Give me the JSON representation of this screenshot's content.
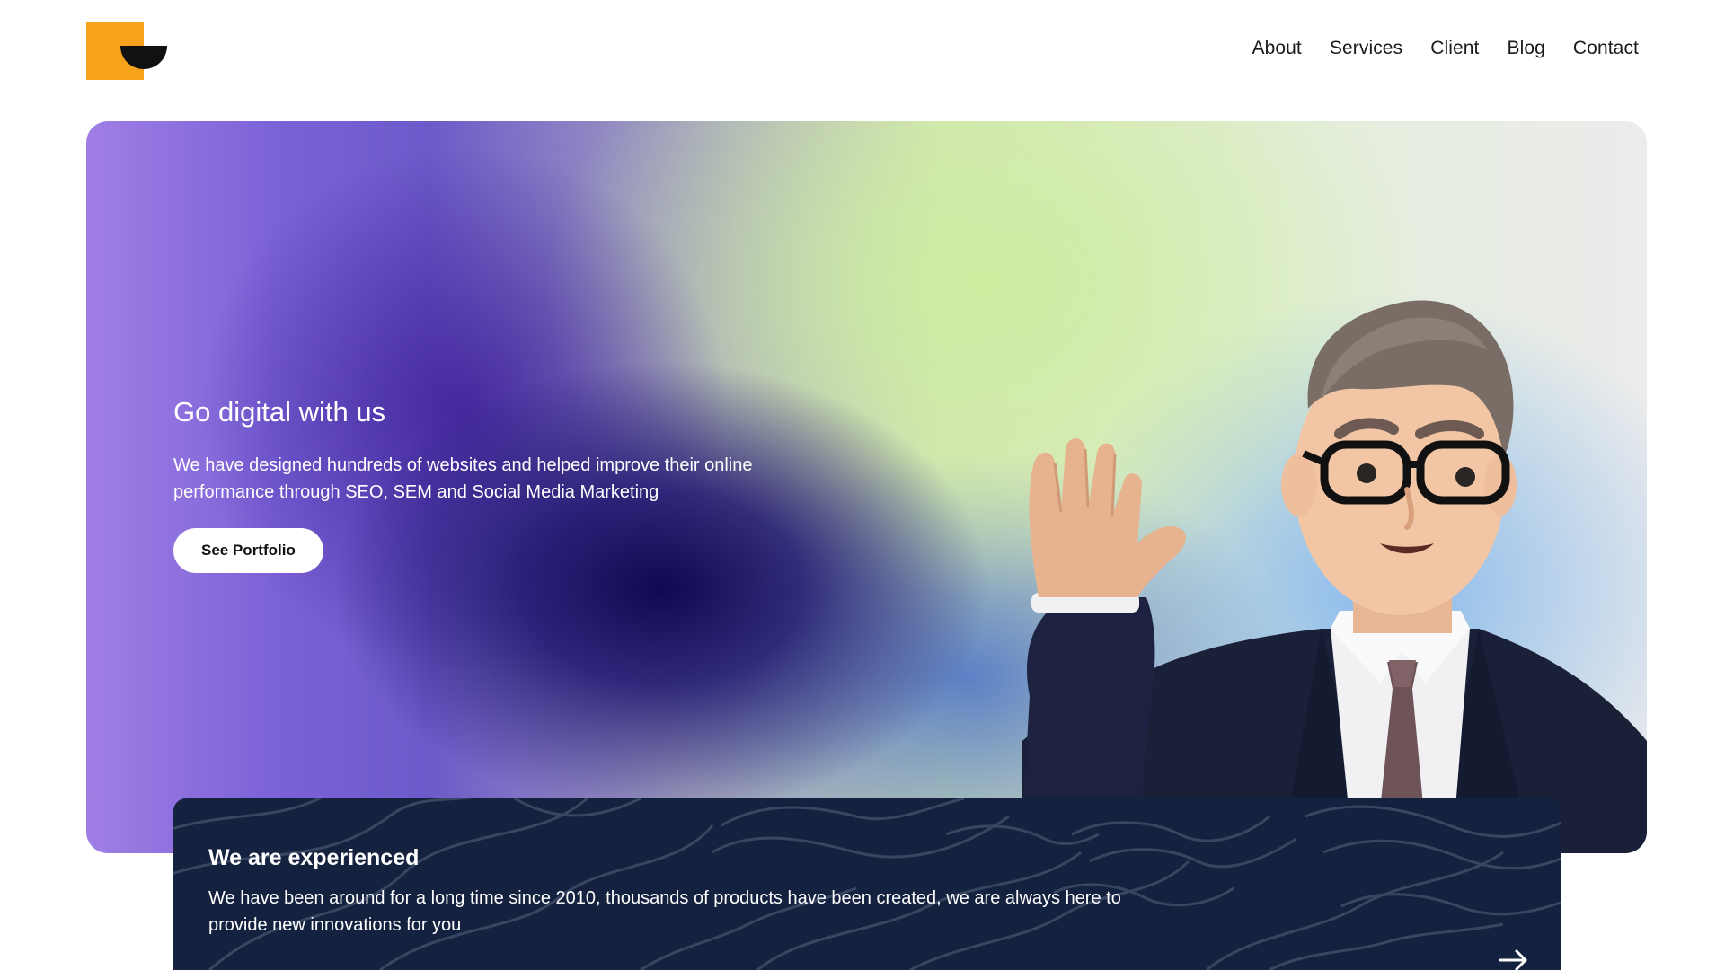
{
  "header": {
    "logo": {
      "name": "brand-logo",
      "colors": {
        "square": "#f6a21a",
        "half_circle": "#111111"
      }
    },
    "nav": [
      {
        "label": "About"
      },
      {
        "label": "Services"
      },
      {
        "label": "Client"
      },
      {
        "label": "Blog"
      },
      {
        "label": "Contact"
      }
    ]
  },
  "hero": {
    "title": "Go digital with us",
    "description": "We have designed hundreds of websites and helped improve their online performance through SEO, SEM and Social Media Marketing",
    "cta_label": "See Portfolio",
    "illustration": "waving-businessman-3d-character"
  },
  "experience": {
    "title": "We are experienced",
    "description": "We have been around for a long time since 2010, thousands of products have been created, we are always here to provide new innovations for you",
    "arrow_icon": "arrow-right-icon",
    "background": "#15223f"
  }
}
